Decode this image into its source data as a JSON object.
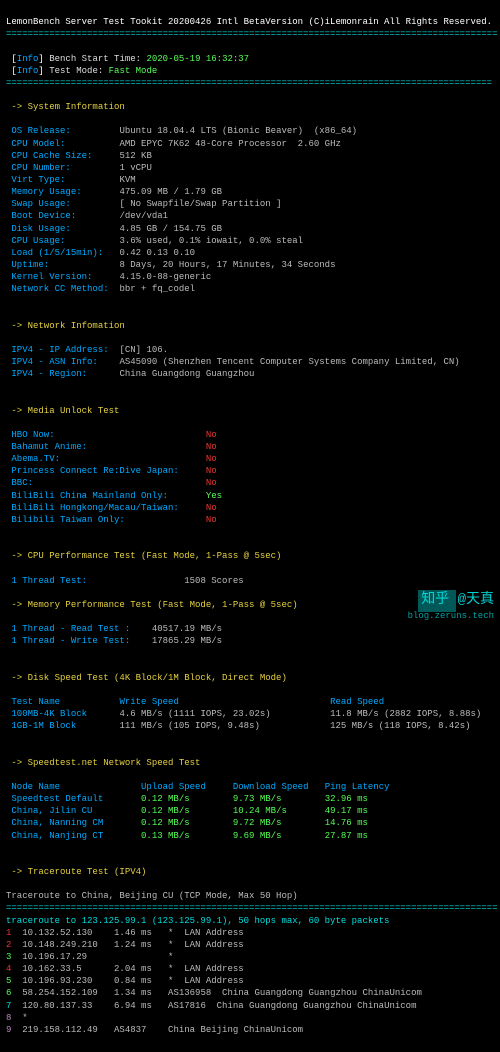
{
  "title": "LemonBench Server Test Tookit 20200426 Intl BetaVersion (C)iLemonrain All Rights Reserved.",
  "ts_label": "Bench Start Time:",
  "ts": " 2020-05-19 16:32:37",
  "mode_label": "Test Mode:",
  "mode": " Fast Mode",
  "sec_sys": "-> System Information",
  "sys": [
    [
      "OS Release:",
      "Ubuntu 18.04.4 LTS (Bionic Beaver)  (x86_64)"
    ],
    [
      "CPU Model:",
      "AMD EPYC 7K62 48-Core Processor  2.60 GHz"
    ],
    [
      "CPU Cache Size:",
      "512 KB"
    ],
    [
      "CPU Number:",
      "1 vCPU"
    ],
    [
      "Virt Type:",
      "KVM"
    ],
    [
      "Memory Usage:",
      "475.09 MB / 1.79 GB"
    ],
    [
      "Swap Usage:",
      "[ No Swapfile/Swap Partition ]"
    ],
    [
      "Boot Device:",
      "/dev/vda1"
    ],
    [
      "Disk Usage:",
      "4.85 GB / 154.75 GB"
    ],
    [
      "CPU Usage:",
      "3.6% used, 0.1% iowait, 0.0% steal"
    ],
    [
      "Load (1/5/15min):",
      "0.42 0.13 0.10"
    ],
    [
      "Uptime:",
      "8 Days, 20 Hours, 17 Minutes, 34 Seconds"
    ],
    [
      "Kernel Version:",
      "4.15.0-88-generic"
    ],
    [
      "Network CC Method:",
      "bbr + fq_codel"
    ]
  ],
  "sec_net": "-> Network Infomation",
  "net": [
    [
      "IPV4 - IP Address:",
      "[CN] 106."
    ],
    [
      "IPV4 - ASN Info:",
      "AS45090 (Shenzhen Tencent Computer Systems Company Limited, CN)"
    ],
    [
      "IPV4 - Region:",
      "China Guangdong Guangzhou"
    ]
  ],
  "sec_media": "-> Media Unlock Test",
  "media": [
    [
      "HBO Now:",
      "No",
      "no"
    ],
    [
      "Bahamut Anime:",
      "No",
      "no"
    ],
    [
      "Abema.TV:",
      "No",
      "no"
    ],
    [
      "Princess Connect Re:Dive Japan:",
      "No",
      "no"
    ],
    [
      "BBC:",
      "No",
      "no"
    ],
    [
      "BiliBili China Mainland Only:",
      "Yes",
      "yes"
    ],
    [
      "BiliBili Hongkong/Macau/Taiwan:",
      "No",
      "no"
    ],
    [
      "Bilibili Taiwan Only:",
      "No",
      "no"
    ]
  ],
  "sec_cpu": "-> CPU Performance Test (Fast Mode, 1-Pass @ 5sec)",
  "cpu": [
    "1 Thread Test:",
    "1508 Scores"
  ],
  "sec_mem": "-> Memory Performance Test (Fast Mode, 1-Pass @ 5sec)",
  "mem": [
    [
      "1 Thread - Read Test :",
      "40517.19 MB/s"
    ],
    [
      "1 Thread - Write Test:",
      "17865.29 MB/s"
    ]
  ],
  "sec_disk": "-> Disk Speed Test (4K Block/1M Block, Direct Mode)",
  "disk_hdr": [
    "Test Name",
    "Write Speed",
    "Read Speed"
  ],
  "disk": [
    [
      "100MB-4K Block",
      "4.6 MB/s (1111 IOPS, 23.02s)",
      "11.8 MB/s (2882 IOPS, 8.88s)"
    ],
    [
      "1GB-1M Block",
      "111 MB/s (105 IOPS, 9.48s)",
      "125 MB/s (118 IOPS, 8.42s)"
    ]
  ],
  "sec_speed": "-> Speedtest.net Network Speed Test",
  "speed_hdr": [
    "Node Name",
    "Upload Speed",
    "Download Speed",
    "Ping Latency"
  ],
  "speed": [
    [
      "Speedtest Default",
      "0.12 MB/s",
      "9.73 MB/s",
      "32.96 ms"
    ],
    [
      "China, Jilin CU",
      "0.12 MB/s",
      "10.24 MB/s",
      "49.17 ms"
    ],
    [
      "China, Nanning CM",
      "0.12 MB/s",
      "9.72 MB/s",
      "14.76 ms"
    ],
    [
      "China, Nanjing CT",
      "0.13 MB/s",
      "9.69 MB/s",
      "27.87 ms"
    ]
  ],
  "sec_trace": "-> Traceroute Test (IPV4)",
  "trace_title": "Traceroute to China, Beijing CU (TCP Mode, Max 50 Hop)",
  "trace_route": "traceroute to 123.125.99.1 (123.125.99.1), 50 hops max, 60 byte packets",
  "hops": [
    {
      "n": "1",
      "c": "hop-r",
      "ip": "10.132.52.130",
      "ms": "1.46 ms",
      "loc": "*  LAN Address"
    },
    {
      "n": "2",
      "c": "hop-r",
      "ip": "10.148.249.210",
      "ms": "1.24 ms",
      "loc": "*  LAN Address"
    },
    {
      "n": "3",
      "c": "hop-g",
      "ip": "10.196.17.29",
      "ms": "",
      "loc": "*"
    },
    {
      "n": "4",
      "c": "hop-r",
      "ip": "10.162.33.5",
      "ms": "2.04 ms",
      "loc": "*  LAN Address"
    },
    {
      "n": "5",
      "c": "hop-g",
      "ip": "10.196.93.230",
      "ms": "0.84 ms",
      "loc": "*  LAN Address"
    },
    {
      "n": "6",
      "c": "hop-g",
      "ip": "58.254.152.109",
      "ms": "1.34 ms",
      "loc": "AS136958  China Guangdong Guangzhou ChinaUnicom"
    },
    {
      "n": "7",
      "c": "hop-c",
      "ip": "120.80.137.33",
      "ms": "6.94 ms",
      "loc": "AS17816  China Guangdong Guangzhou ChinaUnicom"
    },
    {
      "n": "8",
      "c": "hop-p",
      "ip": "*",
      "ms": "",
      "loc": ""
    },
    {
      "n": "9",
      "c": "hop-p",
      "ip": "219.158.112.49",
      "ms": "AS4837",
      "loc": "China Beijing ChinaUnicom"
    }
  ],
  "wm": "知乎 @天真",
  "blog": "blog.zeruns.tech"
}
